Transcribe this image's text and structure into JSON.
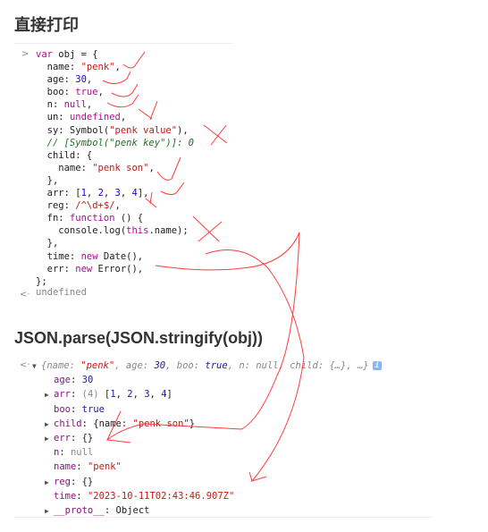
{
  "headings": {
    "direct": "直接打印",
    "json": "JSON.parse(JSON.stringify(obj))"
  },
  "console": {
    "input_prompt": ">",
    "output_prompt": "<·",
    "undefined_text": "undefined",
    "source_lines": [
      [
        [
          "var ",
          "k"
        ],
        [
          "obj = {",
          ""
        ]
      ],
      [
        [
          "  name: ",
          ""
        ],
        [
          "\"penk\"",
          "s"
        ],
        [
          ",",
          ""
        ]
      ],
      [
        [
          "  age: ",
          ""
        ],
        [
          "30",
          "n"
        ],
        [
          ",",
          ""
        ]
      ],
      [
        [
          "  boo: ",
          ""
        ],
        [
          "true",
          "k"
        ],
        [
          ",",
          ""
        ]
      ],
      [
        [
          "  n: ",
          ""
        ],
        [
          "null",
          "k"
        ],
        [
          ",",
          ""
        ]
      ],
      [
        [
          "  un: ",
          ""
        ],
        [
          "undefined",
          "k"
        ],
        [
          ",",
          ""
        ]
      ],
      [
        [
          "  sy: Symbol(",
          ""
        ],
        [
          "\"penk value\"",
          "s"
        ],
        [
          "),",
          ""
        ]
      ],
      [
        [
          "  // [Symbol(\"penk key\")]: 0",
          "c"
        ]
      ],
      [
        [
          "  child: {",
          ""
        ]
      ],
      [
        [
          "    name: ",
          ""
        ],
        [
          "\"penk son\"",
          "s"
        ],
        [
          ",",
          ""
        ]
      ],
      [
        [
          "  },",
          ""
        ]
      ],
      [
        [
          "  arr: [",
          ""
        ],
        [
          "1",
          "n"
        ],
        [
          ", ",
          ""
        ],
        [
          "2",
          "n"
        ],
        [
          ", ",
          ""
        ],
        [
          "3",
          "n"
        ],
        [
          ", ",
          ""
        ],
        [
          "4",
          "n"
        ],
        [
          "],",
          ""
        ]
      ],
      [
        [
          "  reg: ",
          ""
        ],
        [
          "/^\\d+$/",
          "s"
        ],
        [
          ",",
          ""
        ]
      ],
      [
        [
          "  fn: ",
          ""
        ],
        [
          "function",
          "k"
        ],
        [
          " () {",
          ""
        ]
      ],
      [
        [
          "    console.log(",
          ""
        ],
        [
          "this",
          "k"
        ],
        [
          ".name);",
          ""
        ]
      ],
      [
        [
          "  },",
          ""
        ]
      ],
      [
        [
          "  time: ",
          ""
        ],
        [
          "new",
          "k"
        ],
        [
          " Date(),",
          ""
        ]
      ],
      [
        [
          "  err: ",
          ""
        ],
        [
          "new",
          "k"
        ],
        [
          " Error(),",
          ""
        ]
      ],
      [
        [
          "};",
          ""
        ]
      ]
    ],
    "result_summary": [
      [
        "{name: ",
        "g"
      ],
      [
        "\"penk\"",
        "s"
      ],
      [
        ", age: ",
        "g"
      ],
      [
        "30",
        "b"
      ],
      [
        ", boo: ",
        "g"
      ],
      [
        "true",
        "b"
      ],
      [
        ", n: ",
        "g"
      ],
      [
        "null",
        "g"
      ],
      [
        ", child: {…}, …}",
        "g"
      ]
    ],
    "result_props": [
      {
        "expandable": false,
        "parts": [
          [
            "age",
            "p"
          ],
          [
            ": ",
            ""
          ],
          [
            "30",
            "b"
          ]
        ]
      },
      {
        "expandable": true,
        "parts": [
          [
            "arr",
            "p"
          ],
          [
            ": ",
            ""
          ],
          [
            "(4) ",
            "g"
          ],
          [
            "[",
            ""
          ],
          [
            "1",
            "b"
          ],
          [
            ", ",
            ""
          ],
          [
            "2",
            "b"
          ],
          [
            ", ",
            ""
          ],
          [
            "3",
            "b"
          ],
          [
            ", ",
            ""
          ],
          [
            "4",
            "b"
          ],
          [
            "]",
            ""
          ]
        ]
      },
      {
        "expandable": false,
        "parts": [
          [
            "boo",
            "p"
          ],
          [
            ": ",
            ""
          ],
          [
            "true",
            "b"
          ]
        ]
      },
      {
        "expandable": true,
        "parts": [
          [
            "child",
            "p"
          ],
          [
            ": {name: ",
            ""
          ],
          [
            "\"penk son\"",
            "s"
          ],
          [
            "}",
            ""
          ]
        ]
      },
      {
        "expandable": true,
        "parts": [
          [
            "err",
            "p"
          ],
          [
            ": {}",
            ""
          ]
        ]
      },
      {
        "expandable": false,
        "parts": [
          [
            "n",
            "p"
          ],
          [
            ": ",
            ""
          ],
          [
            "null",
            "g"
          ]
        ]
      },
      {
        "expandable": false,
        "parts": [
          [
            "name",
            "p"
          ],
          [
            ": ",
            ""
          ],
          [
            "\"penk\"",
            "s"
          ]
        ]
      },
      {
        "expandable": true,
        "parts": [
          [
            "reg",
            "p"
          ],
          [
            ": {}",
            ""
          ]
        ]
      },
      {
        "expandable": false,
        "parts": [
          [
            "time",
            "p"
          ],
          [
            ": ",
            ""
          ],
          [
            "\"2023-10-11T02:43:46.907Z\"",
            "s"
          ]
        ]
      },
      {
        "expandable": true,
        "parts": [
          [
            "__proto__",
            "p"
          ],
          [
            ": Object",
            ""
          ]
        ]
      }
    ],
    "info_badge": "i"
  },
  "colors": {
    "annotation": "#ff3b3b",
    "string": "#c41a16",
    "keyword": "#aa0d91",
    "number": "#1c00cf"
  }
}
